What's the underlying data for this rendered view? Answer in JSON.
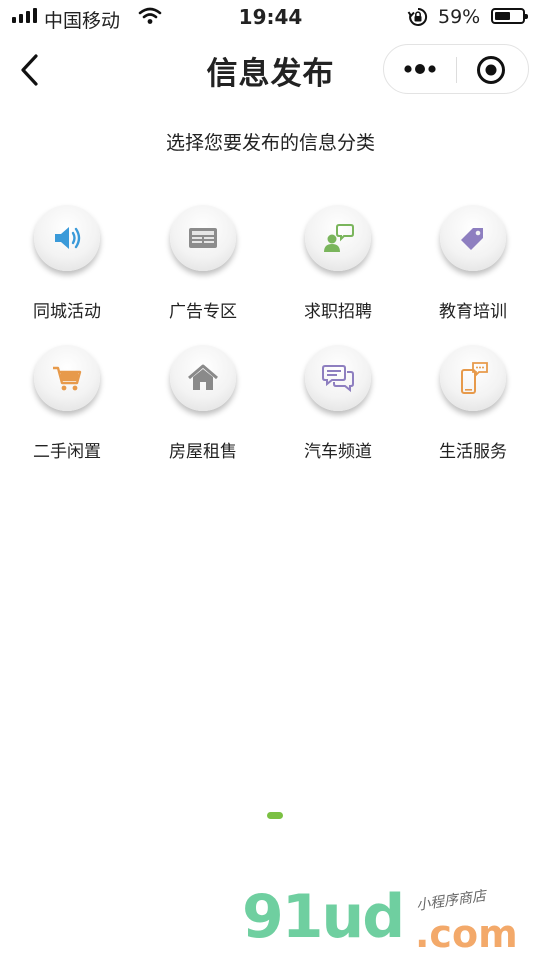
{
  "status_bar": {
    "carrier": "中国移动",
    "time": "19:44",
    "battery_percent": "59%",
    "battery_level": 0.59
  },
  "nav": {
    "title": "信息发布",
    "back_icon": "chevron-left-icon",
    "more_icon": "more-dots-icon",
    "close_icon": "target-circle-icon"
  },
  "subtitle": "选择您要发布的信息分类",
  "categories": [
    {
      "label": "同城活动",
      "icon": "speaker-icon",
      "color": "#3a9ad9"
    },
    {
      "label": "广告专区",
      "icon": "newspaper-icon",
      "color": "#8c8c8c"
    },
    {
      "label": "求职招聘",
      "icon": "person-chat-icon",
      "color": "#7ab55c"
    },
    {
      "label": "教育培训",
      "icon": "tag-icon",
      "color": "#8e7fc0"
    },
    {
      "label": "二手闲置",
      "icon": "shopping-cart-icon",
      "color": "#e79a4b"
    },
    {
      "label": "房屋租售",
      "icon": "house-icon",
      "color": "#8a8a8a"
    },
    {
      "label": "汽车频道",
      "icon": "chat-bubbles-icon",
      "color": "#8e7fc0"
    },
    {
      "label": "生活服务",
      "icon": "phone-icon",
      "color": "#e79a4b"
    }
  ],
  "pager": {
    "current_page": 1,
    "color": "#7bc043"
  },
  "watermark": {
    "main": "91ud",
    "domain": ".com",
    "tagline": "小程序商店"
  }
}
